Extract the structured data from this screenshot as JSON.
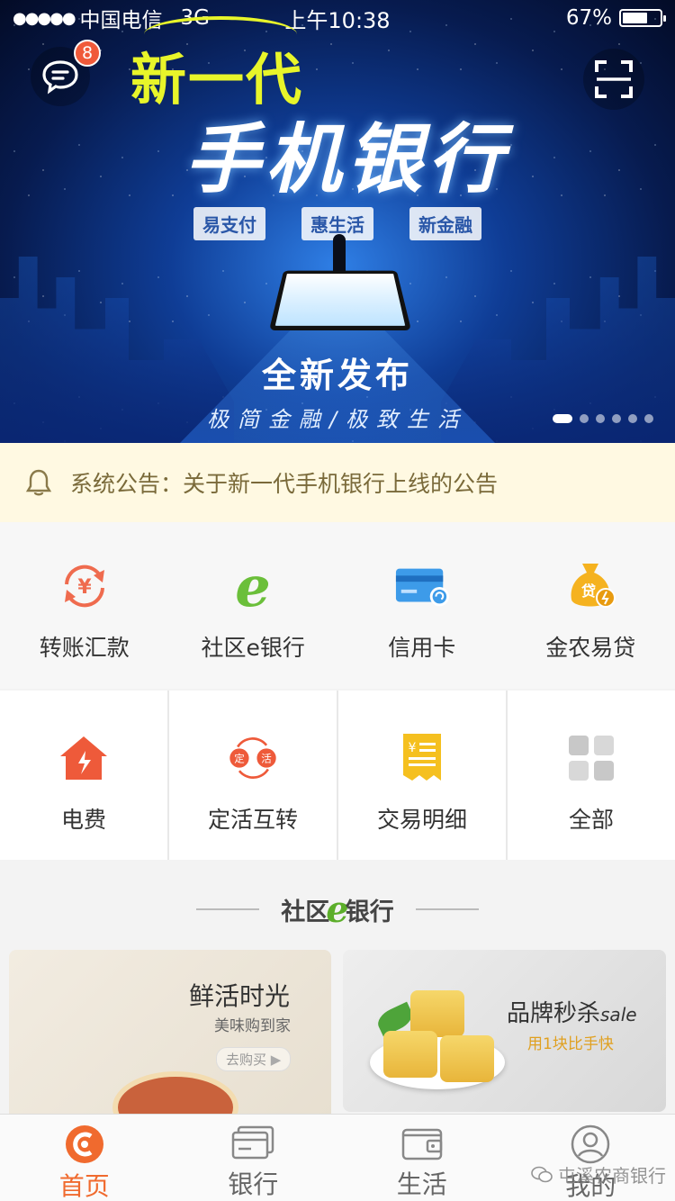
{
  "status_bar": {
    "carrier": "中国电信",
    "network": "3G",
    "time": "上午10:38",
    "battery": "67%",
    "battery_level": 0.67
  },
  "banner": {
    "message_badge": "8",
    "headline_top": "新一代",
    "headline_main": "手机银行",
    "pills": [
      "易支付",
      "惠生活",
      "新金融"
    ],
    "headline_release": "全新发布",
    "slogan": "极简金融/极致生活",
    "page_count": 6,
    "active_page": 1
  },
  "notice": {
    "text": "系统公告：关于新一代手机银行上线的公告"
  },
  "quick_row1": [
    {
      "label": "转账汇款",
      "icon": "transfer-icon"
    },
    {
      "label": "社区e银行",
      "icon": "e-bank-icon"
    },
    {
      "label": "信用卡",
      "icon": "credit-card-icon"
    },
    {
      "label": "金农易贷",
      "icon": "loan-bag-icon"
    }
  ],
  "quick_row2": [
    {
      "label": "电费",
      "icon": "electricity-icon"
    },
    {
      "label": "定活互转",
      "icon": "fixed-current-icon"
    },
    {
      "label": "交易明细",
      "icon": "receipt-icon"
    },
    {
      "label": "全部",
      "icon": "grid-icon"
    }
  ],
  "section": {
    "title_left": "社区",
    "title_e": "e",
    "title_right": "银行"
  },
  "cards": [
    {
      "title": "鲜活时光",
      "subtitle": "美味购到家",
      "button": "去购买"
    },
    {
      "title": "品牌秒杀",
      "title_suffix": "sale",
      "subtitle": "用1块比手快"
    }
  ],
  "tabs": [
    {
      "label": "首页",
      "icon": "home-icon",
      "active": true
    },
    {
      "label": "银行",
      "icon": "bank-icon",
      "active": false
    },
    {
      "label": "生活",
      "icon": "wallet-icon",
      "active": false
    },
    {
      "label": "我的",
      "icon": "user-icon",
      "active": false
    }
  ],
  "watermark": "屯溪农商银行",
  "colors": {
    "accent": "#f06a2e",
    "notice_bg": "#fff9e2",
    "notice_text": "#7a6a3a",
    "banner_yellow": "#e8f52a"
  }
}
